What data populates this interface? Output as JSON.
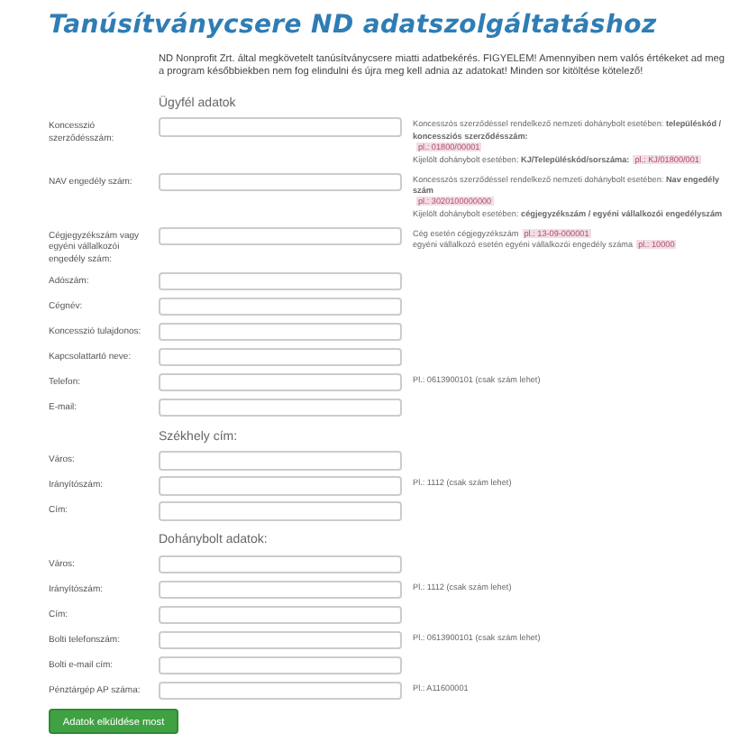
{
  "title": "Tanúsítványcsere ND adatszolgáltatáshoz",
  "intro": "ND Nonprofit Zrt. által megkövetelt tanúsítványcsere miatti adatbekérés. FIGYELEM! Amennyiben nem valós értékeket ad meg a program későbbiekben nem fog elindulni és újra meg kell adnia az adatokat! Minden sor kitöltése kötelező!",
  "rows": [
    {
      "kind": "section",
      "label": "Ügyfél adatok"
    },
    {
      "kind": "field",
      "label": "Koncesszió szerződésszám:",
      "hint": [
        {
          "text": "Koncesszós szerződéssel rendelkező nemzeti dohánybolt esetében: **településkód / koncessziós szerződésszám:**",
          "code": "pl.: 01800/00001"
        },
        {
          "text": "Kijelölt dohánybolt esetében: **KJ/Településkód/sorszáma:**",
          "code": "pl.: KJ/01800/001"
        }
      ]
    },
    {
      "kind": "field",
      "label": "NAV engedély szám:",
      "hint": [
        {
          "text": "Koncesszós szerződéssel rendelkező nemzeti dohánybolt esetében: **Nav engedély szám**",
          "code": "pl.: 3020100000000"
        },
        {
          "text": "Kijelölt dohánybolt esetében: **cégjegyzékszám / egyéni vállalkozói engedélyszám**"
        }
      ]
    },
    {
      "kind": "field",
      "label": "Cégjegyzékszám vagy egyéni vállalkozói engedély szám:",
      "hint": [
        {
          "text": "Cég esetén cégjegyzékszám",
          "code": "pl.: 13-09-000001"
        },
        {
          "text": "egyéni vállalkozó esetén egyéni vállalkozói engedély száma",
          "code": "pl.: 10000"
        }
      ]
    },
    {
      "kind": "field",
      "label": "Adószám:"
    },
    {
      "kind": "field",
      "label": "Cégnév:"
    },
    {
      "kind": "field",
      "label": "Koncesszió tulajdonos:"
    },
    {
      "kind": "field",
      "label": "Kapcsolattartó neve:"
    },
    {
      "kind": "field",
      "label": "Telefon:",
      "hint": [
        {
          "text": "Pl.: 0613900101 (csak szám lehet)"
        }
      ]
    },
    {
      "kind": "field",
      "label": "E-mail:"
    },
    {
      "kind": "section",
      "label": "Székhely cím:"
    },
    {
      "kind": "field",
      "label": "Város:"
    },
    {
      "kind": "field",
      "label": "Irányítószám:",
      "hint": [
        {
          "text": "Pl.: 1112 (csak szám lehet)"
        }
      ]
    },
    {
      "kind": "field",
      "label": "Cím:"
    },
    {
      "kind": "section",
      "label": "Dohánybolt adatok:"
    },
    {
      "kind": "field",
      "label": "Város:"
    },
    {
      "kind": "field",
      "label": "Irányítószám:",
      "hint": [
        {
          "text": "Pl.: 1112 (csak szám lehet)"
        }
      ]
    },
    {
      "kind": "field",
      "label": "Cím:"
    },
    {
      "kind": "field",
      "label": "Bolti telefonszám:",
      "hint": [
        {
          "text": "Pl.: 0613900101 (csak szám lehet)"
        }
      ]
    },
    {
      "kind": "field",
      "label": "Bolti e-mail cím:"
    },
    {
      "kind": "field",
      "label": "Pénztárgép AP száma:",
      "hint": [
        {
          "text": "Pl.: A11600001"
        }
      ]
    }
  ],
  "submit": "Adatok elküldése most"
}
